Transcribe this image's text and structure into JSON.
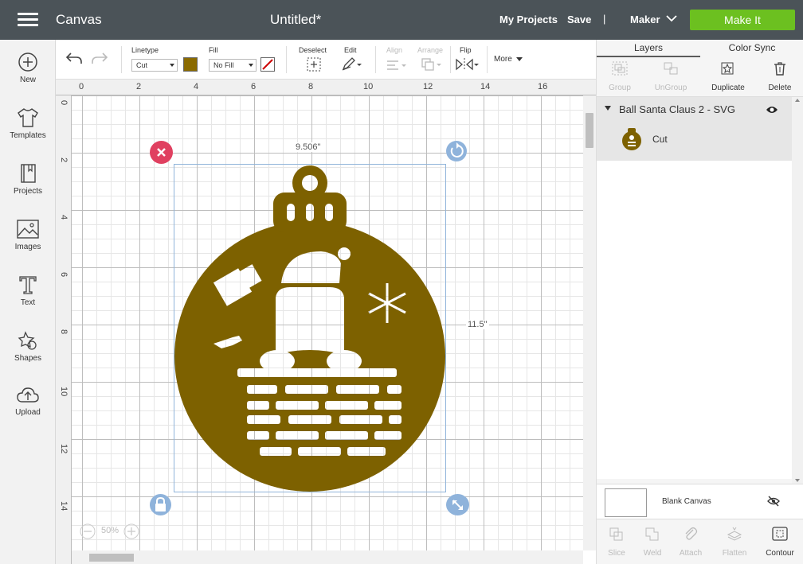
{
  "topbar": {
    "app_name": "Canvas",
    "doc_title": "Untitled*",
    "my_projects": "My Projects",
    "save": "Save",
    "separator": "|",
    "machine": "Maker",
    "make_it": "Make It"
  },
  "sidebar": {
    "items": [
      {
        "label": "New",
        "icon": "plus-circle-icon"
      },
      {
        "label": "Templates",
        "icon": "shirt-icon"
      },
      {
        "label": "Projects",
        "icon": "book-icon"
      },
      {
        "label": "Images",
        "icon": "image-icon"
      },
      {
        "label": "Text",
        "icon": "text-icon"
      },
      {
        "label": "Shapes",
        "icon": "shapes-icon"
      },
      {
        "label": "Upload",
        "icon": "cloud-upload-icon"
      }
    ]
  },
  "toolbar": {
    "linetype_label": "Linetype",
    "linetype_value": "Cut",
    "fill_label": "Fill",
    "fill_value": "No Fill",
    "deselect": "Deselect",
    "edit": "Edit",
    "align": "Align",
    "arrange": "Arrange",
    "flip": "Flip",
    "more": "More",
    "swatch_color": "#8a6a00"
  },
  "canvas": {
    "ruler_x": [
      "0",
      "2",
      "4",
      "6",
      "8",
      "10",
      "12",
      "14",
      "16"
    ],
    "ruler_y": [
      "0",
      "2",
      "4",
      "6",
      "8",
      "10",
      "12",
      "14"
    ],
    "width_label": "9.506\"",
    "height_label": "11.5\"",
    "zoom": "50%",
    "object_color": "#7d6100"
  },
  "layers": {
    "tabs": [
      "Layers",
      "Color Sync"
    ],
    "actions": [
      "Group",
      "UnGroup",
      "Duplicate",
      "Delete"
    ],
    "group_name": "Ball Santa Claus 2 - SVG",
    "child_label": "Cut",
    "blank_canvas": "Blank Canvas",
    "bottom_actions": [
      "Slice",
      "Weld",
      "Attach",
      "Flatten",
      "Contour"
    ]
  }
}
